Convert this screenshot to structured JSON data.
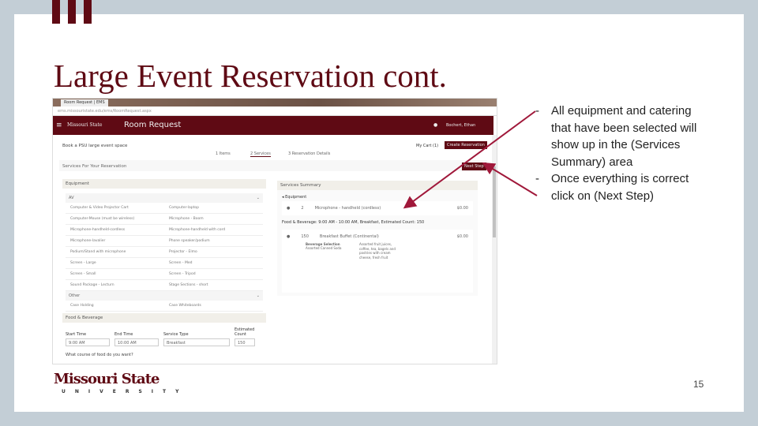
{
  "slide": {
    "title": "Large Event Reservation cont.",
    "page_number": "15",
    "bullets": [
      "All equipment and catering that have been selected will show up in the (Services Summary) area",
      "Once everything is correct click on (Next Step)"
    ],
    "logo": {
      "name": "Missouri State",
      "sub": "UNIVERSITY"
    },
    "accent": "#5f0a14"
  },
  "browser": {
    "tab_title": "Room Request | EMS",
    "url": "ems.missouristate.edu/ems/RoomRequest.aspx"
  },
  "app": {
    "brand": "Missouri State",
    "title": "Room Request",
    "user": "Bochert, Ethan",
    "event_title": "Book a PSU large event space",
    "steps": [
      "1 Items",
      "2 Services",
      "3 Reservation Details"
    ],
    "cart": "My Cart (1)",
    "create_button": "Create Reservation",
    "section_title": "Services For Your Reservation",
    "next_button": "Next Step",
    "equipment": {
      "header": "Equipment",
      "av_label": "AV",
      "av_items": [
        "Computer & Video Projector Cart",
        "Computer-laptop",
        "Computer-Mouse (must be wireless)",
        "Microphone - Boom",
        "Microphone-handheld-cordless",
        "Microphone-handheld with cord",
        "Microphone-lavalier",
        "Phone speaker/podium",
        "Podium/Stand with microphone",
        "Projector - Elmo",
        "Screen - Large",
        "Screen - Med",
        "Screen - Small",
        "Screen - Tripod",
        "Sound Package - Lecturn",
        "Stage Sections - short"
      ],
      "other_label": "Other",
      "other_items": [
        "Case Holding",
        "Case Whiteboards"
      ]
    },
    "food": {
      "header": "Food & Beverage",
      "fields": [
        {
          "label": "Start Time",
          "value": "9:00 AM"
        },
        {
          "label": "End Time",
          "value": "10:00 AM"
        },
        {
          "label": "Service Type",
          "value": "Breakfast"
        },
        {
          "label": "Estimated Count",
          "value": "150"
        }
      ],
      "question": "What course of food do you want?"
    },
    "summary": {
      "header": "Services Summary",
      "equipment_label": "Equipment",
      "equipment_item": {
        "qty": "2",
        "name": "Microphone - handheld (cordless)",
        "price": "$0.00"
      },
      "food_line": "Food & Beverage: 9:00 AM - 10:00 AM, Breakfast, Estimated Count: 150",
      "food_item": {
        "qty": "150",
        "name": "Breakfast Buffet (Continental)",
        "price": "$0.00",
        "beverage_label": "Beverage Selection",
        "beverage_value": "Assorted Canned Soda",
        "desc": "Assorted fruit juices, coffee, tea, bagels and pastries with cream cheese, fresh fruit"
      }
    }
  }
}
